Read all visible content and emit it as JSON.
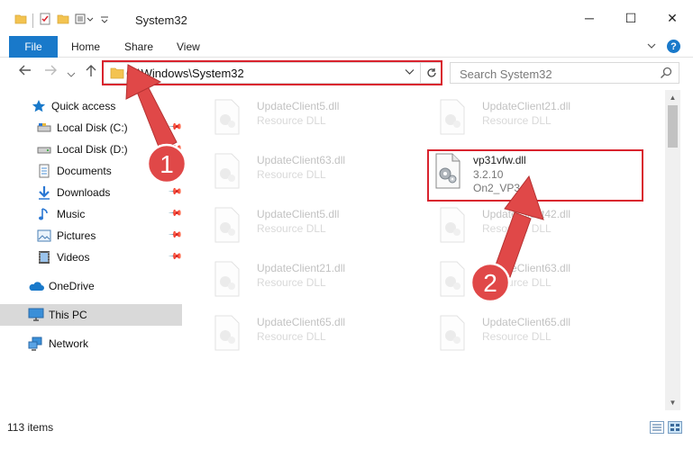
{
  "window": {
    "title": "System32",
    "minimize": "─",
    "maximize": "☐",
    "close": "✕"
  },
  "ribbon": {
    "tabs": [
      "File",
      "Home",
      "Share",
      "View"
    ]
  },
  "address": {
    "path": "C:\\Windows\\System32",
    "search_placeholder": "Search System32"
  },
  "sidebar": {
    "items": [
      {
        "label": "Quick access",
        "icon": "star-icon",
        "pinned": false
      },
      {
        "label": "Local Disk (C:)",
        "icon": "drive-icon",
        "pinned": true
      },
      {
        "label": "Local Disk (D:)",
        "icon": "drive-icon",
        "pinned": true
      },
      {
        "label": "Documents",
        "icon": "documents-icon",
        "pinned": true
      },
      {
        "label": "Downloads",
        "icon": "download-icon",
        "pinned": true
      },
      {
        "label": "Music",
        "icon": "music-icon",
        "pinned": true
      },
      {
        "label": "Pictures",
        "icon": "pictures-icon",
        "pinned": true
      },
      {
        "label": "Videos",
        "icon": "videos-icon",
        "pinned": true
      },
      {
        "label": "OneDrive",
        "icon": "cloud-icon",
        "pinned": false
      },
      {
        "label": "This PC",
        "icon": "computer-icon",
        "pinned": false
      },
      {
        "label": "Network",
        "icon": "network-icon",
        "pinned": false
      }
    ],
    "selected": "This PC"
  },
  "files": [
    {
      "name": "UpdateClient5.dll",
      "type": "Resource DLL"
    },
    {
      "name": "UpdateClient21.dll",
      "type": "Resource DLL"
    },
    {
      "name": "UpdateClient63.dll",
      "type": "Resource DLL"
    },
    {
      "name": "vp31vfw.dll",
      "version": "3.2.10",
      "company": "On2_VP3"
    },
    {
      "name": "UpdateClient5.dll",
      "type": "Resource DLL"
    },
    {
      "name": "UpdateClient42.dll",
      "type": "Resource DLL"
    },
    {
      "name": "UpdateClient21.dll",
      "type": "Resource DLL"
    },
    {
      "name": "UpdateClient63.dll",
      "type": "Resource DLL"
    },
    {
      "name": "UpdateClient65.dll",
      "type": "Resource DLL"
    },
    {
      "name": "UpdateClient65.dll",
      "type": "Resource DLL"
    }
  ],
  "status": {
    "item_count": "113 items"
  },
  "annotations": {
    "step1": "1",
    "step2": "2"
  },
  "colors": {
    "accent": "#1979ca",
    "highlight": "#d9232e",
    "arrow": "#e04848",
    "selected_bg": "#d9d9d9"
  }
}
